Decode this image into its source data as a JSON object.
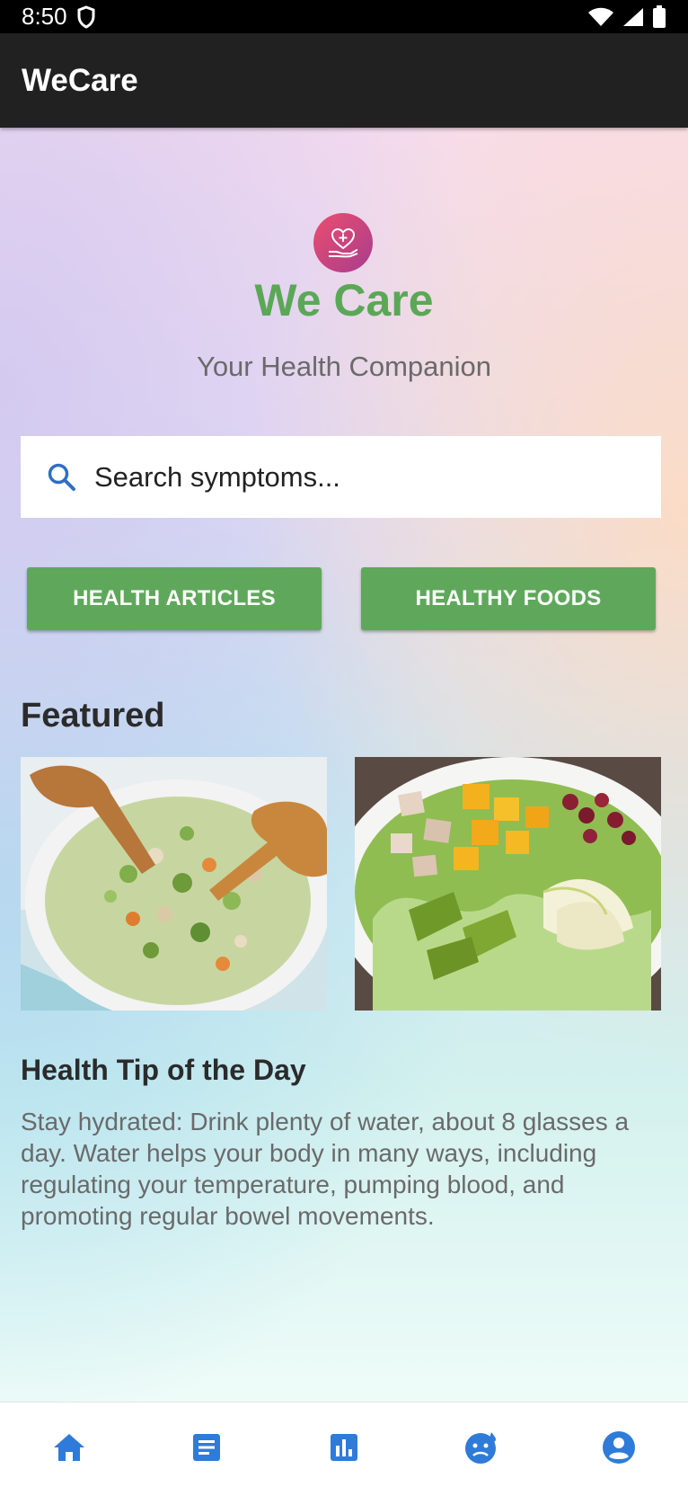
{
  "status_bar": {
    "time": "8:50"
  },
  "app_bar": {
    "title": "WeCare"
  },
  "hero": {
    "logo_icon": "heart-care-hand-icon",
    "title": "We Care",
    "subtitle": "Your Health Companion"
  },
  "search": {
    "placeholder": "Search symptoms...",
    "value": ""
  },
  "actions": {
    "health_articles": "HEALTH ARTICLES",
    "healthy_foods": "HEALTHY FOODS"
  },
  "featured": {
    "title": "Featured",
    "items": [
      {
        "image": "chopped-chicken-salad-bowl"
      },
      {
        "image": "chicken-mango-avocado-salad-plate"
      }
    ]
  },
  "tip": {
    "title": "Health Tip of the Day",
    "text": "Stay hydrated: Drink plenty of water, about 8 glasses a day. Water helps your body in many ways, including regulating your temperature, pumping blood, and promoting regular bowel movements."
  },
  "bottom_nav": {
    "items": [
      {
        "icon": "home-icon",
        "active": true
      },
      {
        "icon": "article-icon",
        "active": false
      },
      {
        "icon": "stats-chart-icon",
        "active": false
      },
      {
        "icon": "sick-face-icon",
        "active": false
      },
      {
        "icon": "account-circle-icon",
        "active": false
      }
    ]
  },
  "colors": {
    "accent_green": "#5fa85b",
    "title_green": "#5aa856",
    "nav_blue": "#2f7bd9",
    "app_bar": "#212121"
  }
}
